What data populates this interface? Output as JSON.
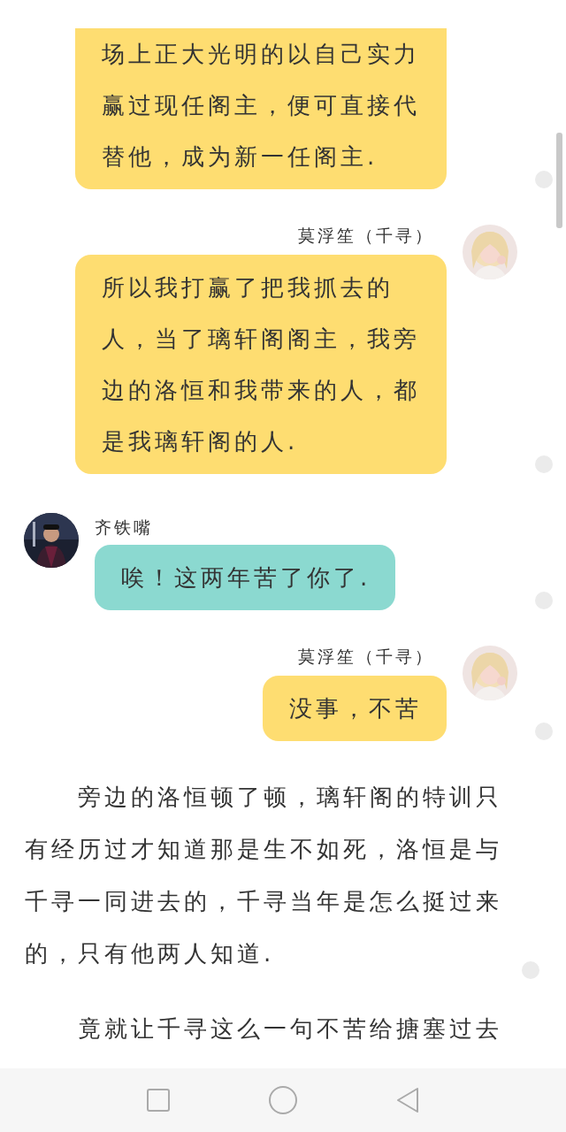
{
  "messages": [
    {
      "kind": "outgoing",
      "color": "#fedd71",
      "marker": true,
      "text": "场上正大光明的以自己实力赢过现任阁主，便可直接代替他，成为新一任阁主."
    },
    {
      "kind": "outgoing",
      "color": "#fedd71",
      "marker": true,
      "sender": "莫浮笙（千寻）",
      "text": "所以我打赢了把我抓去的人，当了璃轩阁阁主，我旁边的洛恒和我带来的人，都是我璃轩阁的人."
    },
    {
      "kind": "incoming",
      "color": "#8bd9d0",
      "marker": true,
      "sender": "齐铁嘴",
      "text": "唉！这两年苦了你了."
    },
    {
      "kind": "outgoing",
      "color": "#fedd71",
      "marker": true,
      "sender": "莫浮笙（千寻）",
      "text": "没事，不苦"
    },
    {
      "kind": "paragraph",
      "marker": true,
      "text": "旁边的洛恒顿了顿，璃轩阁的特训只有经历过才知道那是生不如死，洛恒是与千寻一同进去的，千寻当年是怎么挺过来的，只有他两人知道."
    },
    {
      "kind": "paragraph",
      "marker": false,
      "text": "竟就让千寻这么一句不苦给搪塞过去"
    }
  ],
  "nav_bar": {
    "buttons": [
      {
        "kind": "square"
      },
      {
        "kind": "circle"
      },
      {
        "kind": "triangle"
      }
    ]
  }
}
